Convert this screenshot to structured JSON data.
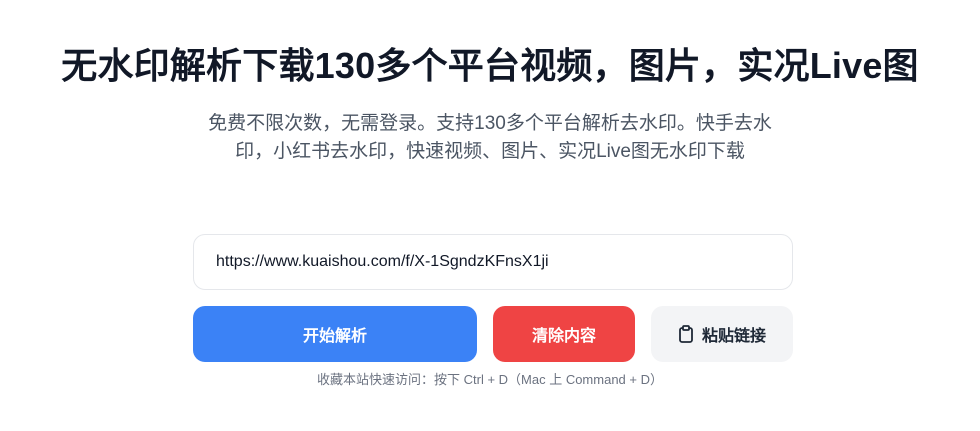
{
  "header": {
    "title": "无水印解析下载130多个平台视频，图片，实况Live图",
    "subtitle": "免费不限次数，无需登录。支持130多个平台解析去水印。快手去水印，小红书去水印，快速视频、图片、实况Live图无水印下载"
  },
  "form": {
    "url_value": "https://www.kuaishou.com/f/X-1SgndzKFnsX1ji",
    "start_label": "开始解析",
    "clear_label": "清除内容",
    "paste_label": "粘贴链接",
    "paste_icon": "clipboard-icon"
  },
  "footer": {
    "hint": "收藏本站快速访问：按下 Ctrl + D（Mac 上 Command + D）"
  },
  "colors": {
    "primary": "#3b82f6",
    "danger": "#ef4444",
    "neutral_bg": "#f3f4f6"
  }
}
